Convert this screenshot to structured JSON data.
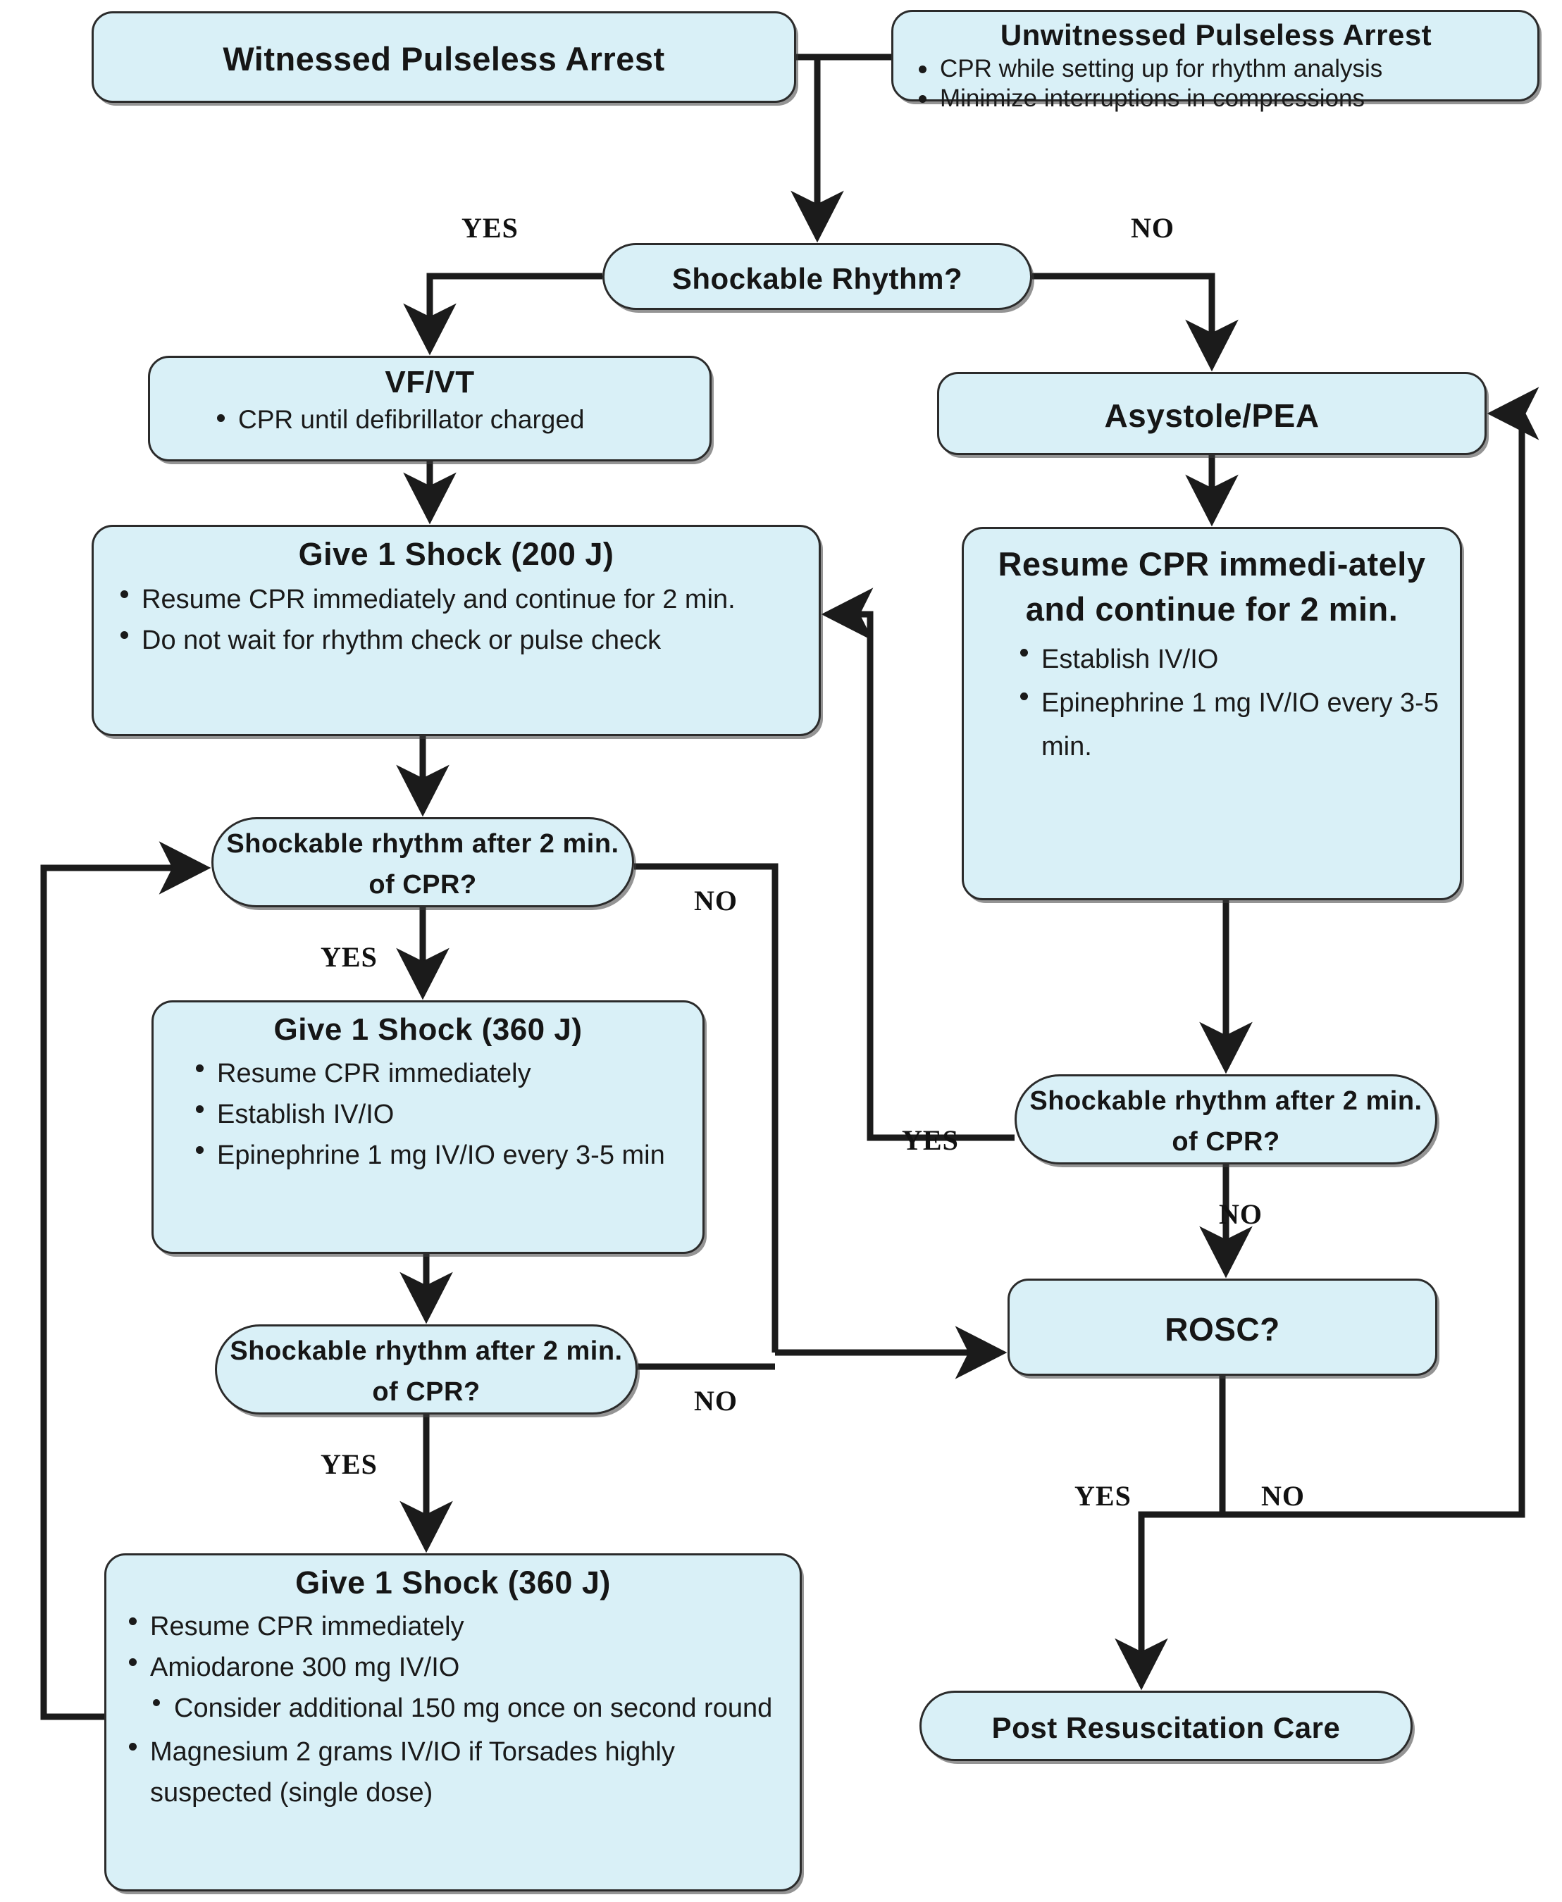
{
  "theme": {
    "node_fill": "#d9f0f7",
    "node_border": "#2b2b2b",
    "line_color": "#1b1b1b",
    "text_color": "#161616",
    "page_background": "#ffffff"
  },
  "nodes": {
    "witnessed": {
      "title": "Witnessed Pulseless Arrest"
    },
    "unwitnessed": {
      "title": "Unwitnessed Pulseless Arrest",
      "bullets": [
        "CPR while setting up for rhythm analysis",
        "Minimize interruptions in compressions"
      ]
    },
    "shockable_rhythm_q": {
      "title": "Shockable Rhythm?"
    },
    "vfvt": {
      "title": "VF/VT",
      "bullets": [
        "CPR until defibrillator charged"
      ]
    },
    "asystole_pea": {
      "title": "Asystole/PEA"
    },
    "shock_200": {
      "title": "Give 1 Shock (200 J)",
      "bullets": [
        "Resume CPR immediately and continue for 2 min.",
        "Do not wait for rhythm check or pulse check"
      ]
    },
    "resume_cpr": {
      "title": "Resume CPR immedi-ately and continue for 2 min.",
      "bullets": [
        "Establish IV/IO",
        "Epinephrine 1 mg IV/IO every 3-5 min."
      ]
    },
    "q_after_2min_1": {
      "title": "Shockable rhythm after 2 min. of CPR?"
    },
    "shock_360_a": {
      "title": "Give 1 Shock (360 J)",
      "bullets": [
        "Resume CPR immediately",
        "Establish IV/IO",
        "Epinephrine 1 mg IV/IO every 3-5 min"
      ]
    },
    "q_after_2min_2": {
      "title": "Shockable rhythm after 2 min. of CPR?"
    },
    "q_after_2min_3": {
      "title": "Shockable rhythm after 2 min. of CPR?"
    },
    "rosc_q": {
      "title": "ROSC?"
    },
    "shock_360_b": {
      "title": "Give 1 Shock (360 J)",
      "bullets": [
        "Resume CPR immediately",
        "Amiodarone 300 mg IV/IO",
        "Magnesium 2 grams IV/IO if Torsades highly suspected (single dose)"
      ],
      "subbullets": [
        "Consider additional 150 mg once on second round"
      ]
    },
    "post_care": {
      "title": "Post Resuscitation Care"
    }
  },
  "edge_labels": {
    "yes_shockable": "YES",
    "no_shockable": "NO",
    "no_after2min_1": "NO",
    "yes_after2min_1": "YES",
    "yes_after2min_2": "YES",
    "no_after2min_2": "NO",
    "no_after2min_3": "NO",
    "yes_after2min_3": "YES",
    "yes_rosc": "YES",
    "no_rosc": "NO"
  }
}
